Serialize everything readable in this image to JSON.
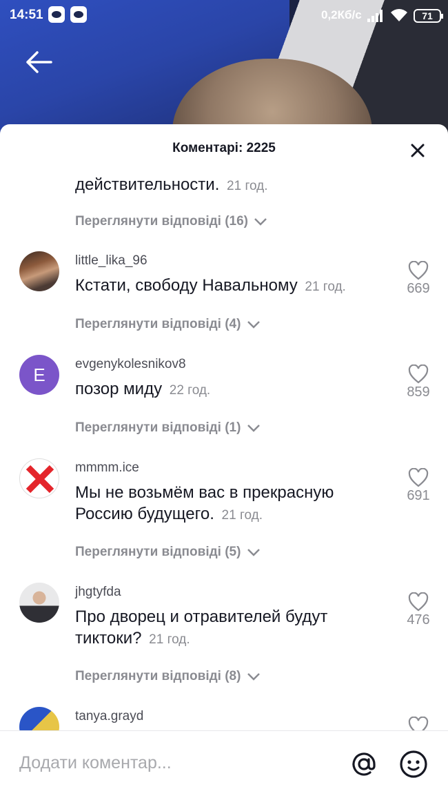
{
  "status_bar": {
    "time": "14:51",
    "network_speed": "0,2Кб/с",
    "battery": "71"
  },
  "sheet": {
    "title": "Коментарі: 2225"
  },
  "comments": [
    {
      "username": "",
      "text": "действительности.",
      "time": "21 год.",
      "likes": "",
      "replies": "Переглянути відповіді (16)"
    },
    {
      "username": "little_lika_96",
      "text": "Кстати, свободу Навальному",
      "time": "21 год.",
      "likes": "669",
      "replies": "Переглянути відповіді (4)",
      "avatar": "photo"
    },
    {
      "username": "evgenykolesnikov8",
      "text": "позор миду",
      "time": "22 год.",
      "likes": "859",
      "replies": "Переглянути відповіді (1)",
      "avatar_letter": "E"
    },
    {
      "username": "mmmm.ice",
      "text": "Мы не возьмём вас в прекрасную Россию будущего.",
      "time": "21 год.",
      "likes": "691",
      "replies": "Переглянути відповіді (5)",
      "avatar": "red-x"
    },
    {
      "username": "jhgtyfda",
      "text": "Про дворец и отравителей будут тиктоки?",
      "time": "21 год.",
      "likes": "476",
      "replies": "Переглянути відповіді (8)",
      "avatar": "photo"
    },
    {
      "username": "tanya.grayd",
      "text": "",
      "time": "",
      "likes": "",
      "replies": "",
      "avatar": "photo"
    }
  ],
  "input": {
    "placeholder": "Додати коментар..."
  },
  "colors": {
    "text_primary": "#161823",
    "text_secondary": "#8a8b91",
    "avatar_letter_bg": "#7b55c9",
    "x_mark": "#e4252b"
  },
  "icons": [
    "back-arrow-icon",
    "close-icon",
    "heart-icon",
    "chevron-down-icon",
    "at-icon",
    "emoji-icon"
  ]
}
